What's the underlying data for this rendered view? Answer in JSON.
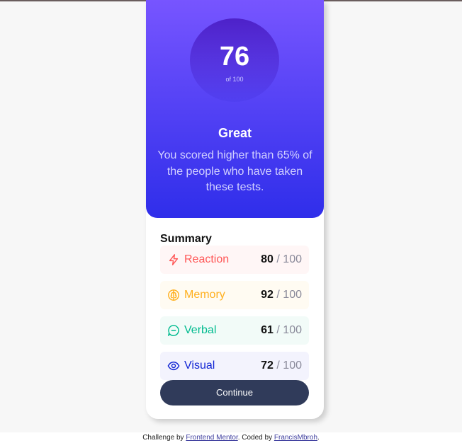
{
  "result": {
    "score": "76",
    "score_of": "of 100",
    "rating": "Great",
    "description": "You scored higher than 65% of the people who have taken these tests."
  },
  "summary": {
    "title": "Summary",
    "items": [
      {
        "label": "Reaction",
        "score": "80",
        "max": "/ 100",
        "icon": "lightning-icon",
        "color": "#ff5757",
        "bg": "#fff6f6"
      },
      {
        "label": "Memory",
        "score": "92",
        "max": "/ 100",
        "icon": "brain-icon",
        "color": "#ffb01f",
        "bg": "#fffbf2"
      },
      {
        "label": "Verbal",
        "score": "61",
        "max": "/ 100",
        "icon": "chat-bubble-icon",
        "color": "#00bb8f",
        "bg": "#f2fbf8"
      },
      {
        "label": "Visual",
        "score": "72",
        "max": "/ 100",
        "icon": "eye-icon",
        "color": "#1125d4",
        "bg": "#f3f3fd"
      }
    ]
  },
  "continue_label": "Continue",
  "attribution": {
    "prefix": "Challenge by ",
    "link1": "Frontend Mentor",
    "middle": ". Coded by ",
    "link2": "FrancisMbroh",
    "suffix": "."
  }
}
